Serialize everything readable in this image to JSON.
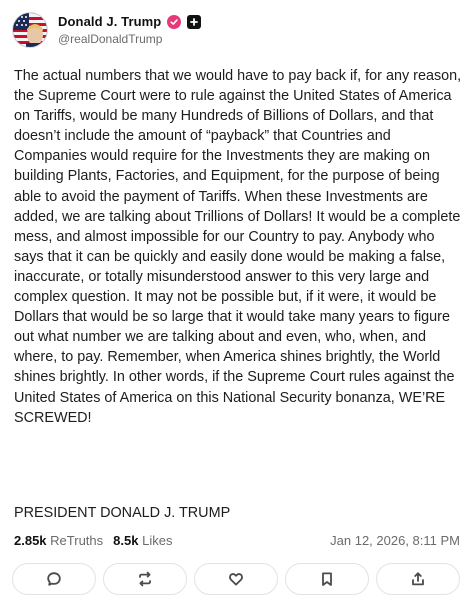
{
  "author": {
    "display_name": "Donald J. Trump",
    "handle": "@realDonaldTrump",
    "avatar_icon": "flag-avatar",
    "verified_icon": "verified-badge-icon",
    "plus_icon": "plus-badge-icon",
    "verified_color": "#e6397a"
  },
  "post": {
    "body": "The actual numbers that we would have to pay back if, for any reason, the Supreme Court were to rule against the United States of America on Tariffs, would be many Hundreds of Billions of Dollars, and that doesn’t include the amount of “payback” that Countries and Companies would require for the Investments they are making on building Plants, Factories, and Equipment, for the purpose of being able to avoid the payment of Tariffs. When these Investments are added, we are talking about Trillions of Dollars! It would be a complete mess, and almost impossible for our Country to pay. Anybody who says that it can be quickly and easily done would be making a false, inaccurate, or totally misunderstood answer to this very large and complex question. It may not be possible but, if it were, it would be Dollars that would be so large that it would take many years to figure out what number we are talking about and even, who, when, and where, to pay. Remember, when America shines brightly, the World shines brightly. In other words, if the Supreme Court rules against the United States of America on this National Security bonanza, WE’RE SCREWED!",
    "signature": "PRESIDENT DONALD J. TRUMP"
  },
  "stats": {
    "retruths_count": "2.85k",
    "retruths_label": "ReTruths",
    "likes_count": "8.5k",
    "likes_label": "Likes",
    "timestamp": "Jan 12, 2026, 8:11 PM"
  },
  "actions": [
    {
      "name": "reply",
      "icon": "comment-icon"
    },
    {
      "name": "retruth",
      "icon": "repost-icon"
    },
    {
      "name": "like",
      "icon": "heart-icon"
    },
    {
      "name": "bookmark",
      "icon": "bookmark-icon"
    },
    {
      "name": "share",
      "icon": "share-icon"
    }
  ]
}
